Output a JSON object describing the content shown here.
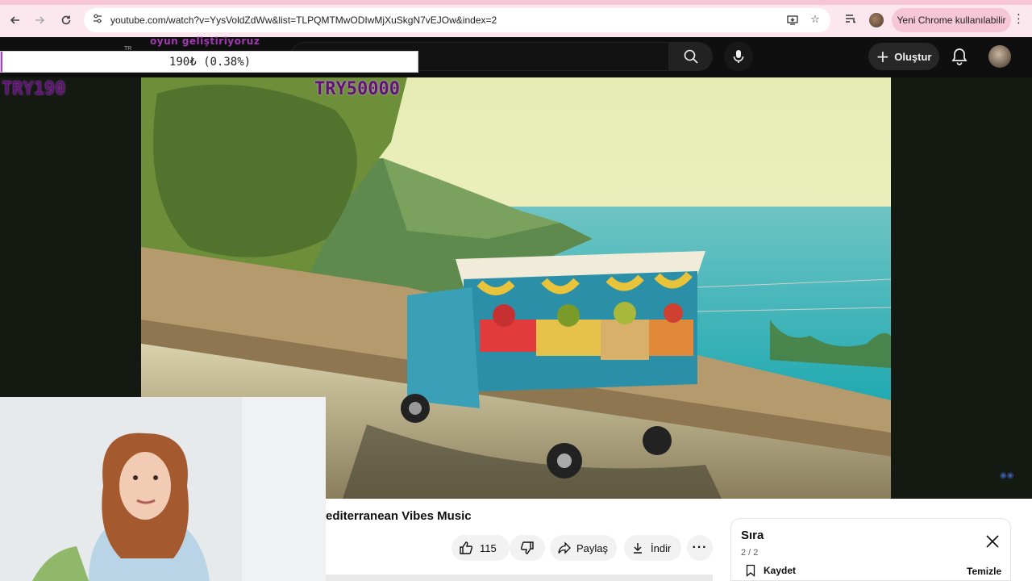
{
  "browser": {
    "url": "youtube.com/watch?v=YysVoldZdWw&list=TLPQMTMwODIwMjXuSkgN7vEJOw&index=2",
    "update_button": "Yeni Chrome kullanılabilir",
    "icons": [
      "back-icon",
      "forward-icon",
      "reload-icon",
      "site-settings-icon",
      "install-app-icon",
      "bookmark-star-icon",
      "reading-list-icon",
      "chrome-profile-icon",
      "chrome-menu-icon"
    ]
  },
  "stream_overlay": {
    "goal_title": "oyun geliştiriyoruz",
    "tiny_tag": "TR",
    "progress_label": "190₺ (0.38%)",
    "progress_fraction": 0.0038,
    "current_amount": "TRY190",
    "goal_amount": "TRY50000",
    "accent_color": "#b13ad0"
  },
  "youtube": {
    "create_label": "Oluştur",
    "video_title": "editerranean Vibes Music",
    "like_count": "115",
    "share_label": "Paylaş",
    "download_label": "İndir",
    "queue": {
      "title": "Sıra",
      "count": "2 / 2",
      "save_label": "Kaydet",
      "clear_label": "Temizle"
    }
  }
}
